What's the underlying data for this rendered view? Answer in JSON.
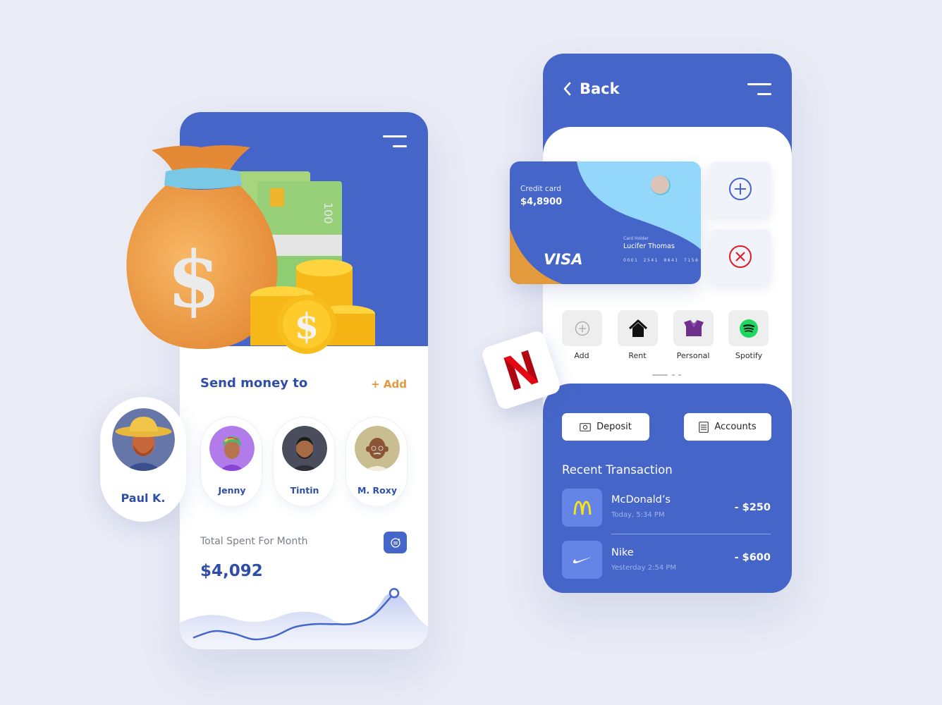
{
  "colors": {
    "primary": "#4566c8",
    "primary_dark_text": "#2f4ea8",
    "accent_orange": "#e39a3c",
    "background": "#e9ebf5",
    "tile_light": "#6585e6",
    "danger": "#e01b24"
  },
  "left_phone": {
    "menu_icon": "hamburger-menu-icon",
    "illustration": "money-bag-coins-cash",
    "send_money": {
      "title": "Send money to",
      "add_label": "+  Add",
      "featured_contact": {
        "name": "Paul K.",
        "avatar": "avatar-man-straw-hat"
      },
      "contacts": [
        {
          "name": "Jenny",
          "avatar": "avatar-woman-rainbow-hair"
        },
        {
          "name": "Tintin",
          "avatar": "avatar-man-beard"
        },
        {
          "name": "M. Roxy",
          "avatar": "avatar-old-man-glasses"
        }
      ]
    },
    "spending": {
      "label": "Total Spent For Month",
      "value": "$4,092",
      "icon": "exchange-icon"
    }
  },
  "chart_data": {
    "type": "line",
    "title": "",
    "xlabel": "",
    "ylabel": "",
    "x": [
      0,
      1,
      2,
      3,
      4,
      5,
      6,
      7,
      8,
      9,
      10
    ],
    "series": [
      {
        "name": "spending",
        "values": [
          12,
          22,
          18,
          9,
          14,
          28,
          33,
          33,
          34,
          48,
          82
        ]
      }
    ],
    "ylim": [
      0,
      100
    ],
    "highlight_last_point": true,
    "grid": false
  },
  "right_phone": {
    "header": {
      "back_label": "Back",
      "back_icon": "chevron-left-icon",
      "menu_icon": "hamburger-menu-icon"
    },
    "credit_card": {
      "label": "Credit card",
      "balance": "$4,8900",
      "holder_label": "Card Holder",
      "holder_name": "Lucifer Thomas",
      "number": "0001 2541 8641 7156",
      "brand": "VISA"
    },
    "card_actions": [
      {
        "name": "add-card",
        "icon": "plus-circle-icon"
      },
      {
        "name": "remove-card",
        "icon": "close-circle-icon"
      }
    ],
    "categories": [
      {
        "label": "Add",
        "icon": "plus-circle-icon"
      },
      {
        "label": "Rent",
        "icon": "house-icon"
      },
      {
        "label": "Personal",
        "icon": "box-icon"
      },
      {
        "label": "Spotify",
        "icon": "spotify-icon"
      }
    ],
    "floating_app": {
      "name": "Netflix",
      "icon": "netflix-icon"
    },
    "buttons": {
      "deposit": "Deposit",
      "accounts": "Accounts"
    },
    "recent": {
      "title": "Recent Transaction",
      "items": [
        {
          "merchant": "McDonald’s",
          "time": "Today, 5:34 PM",
          "amount": "- $250",
          "icon": "mcdonalds-icon"
        },
        {
          "merchant": "Nike",
          "time": "Yesterday 2:54 PM",
          "amount": "- $600",
          "icon": "nike-icon"
        }
      ]
    }
  }
}
